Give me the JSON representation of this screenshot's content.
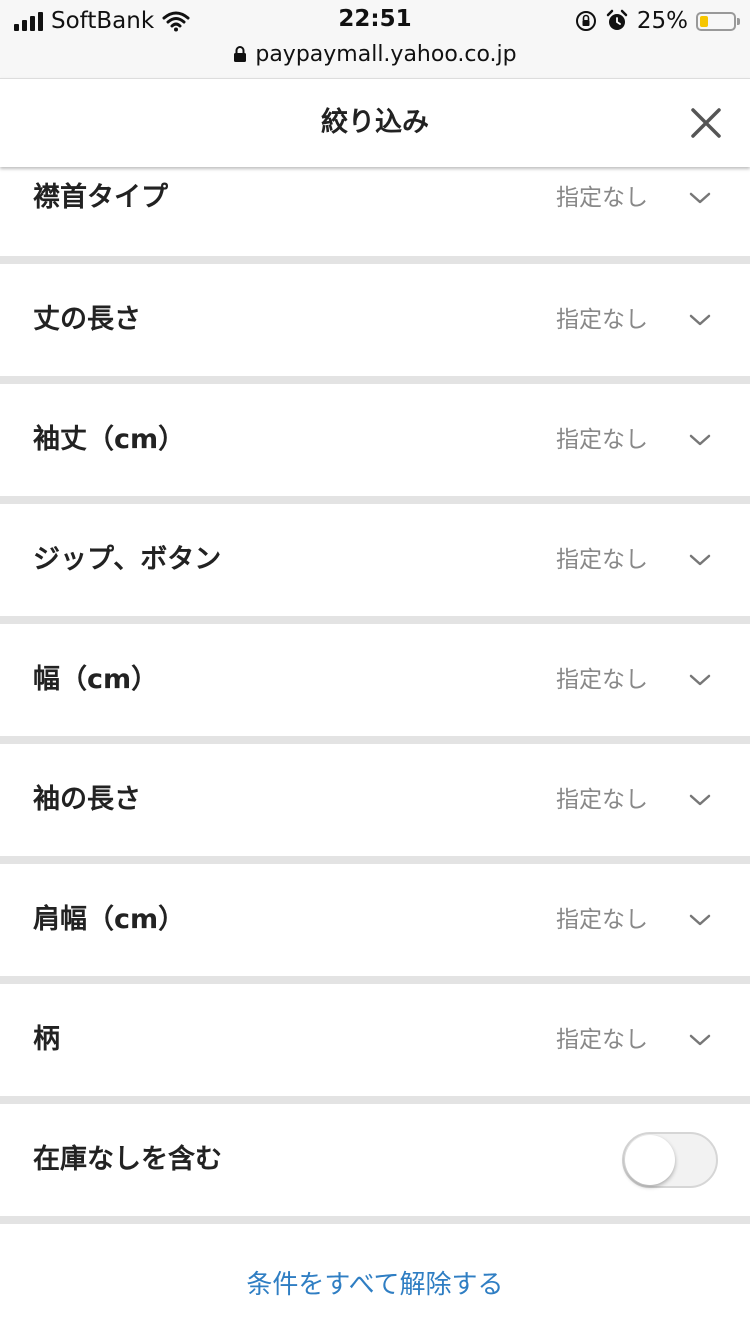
{
  "status_bar": {
    "carrier": "SoftBank",
    "time": "22:51",
    "battery_percent": "25%",
    "battery_level": 0.25,
    "battery_color": "#f7c600",
    "icons": [
      "cellular-signal-icon",
      "wifi-icon",
      "orientation-lock-icon",
      "alarm-icon",
      "battery-icon"
    ]
  },
  "browser": {
    "url": "paypaymall.yahoo.co.jp",
    "lock_icon": "lock-icon"
  },
  "header": {
    "title": "絞り込み",
    "close_icon": "close-icon"
  },
  "filters": [
    {
      "label": "襟首タイプ",
      "value": "指定なし"
    },
    {
      "label": "丈の長さ",
      "value": "指定なし"
    },
    {
      "label": "袖丈（cm）",
      "value": "指定なし"
    },
    {
      "label": "ジップ、ボタン",
      "value": "指定なし"
    },
    {
      "label": "幅（cm）",
      "value": "指定なし"
    },
    {
      "label": "袖の長さ",
      "value": "指定なし"
    },
    {
      "label": "肩幅（cm）",
      "value": "指定なし"
    },
    {
      "label": "柄",
      "value": "指定なし"
    }
  ],
  "out_of_stock": {
    "label": "在庫なしを含む",
    "enabled": false
  },
  "reset": {
    "label": "条件をすべて解除する",
    "color": "#2f7ec3"
  }
}
